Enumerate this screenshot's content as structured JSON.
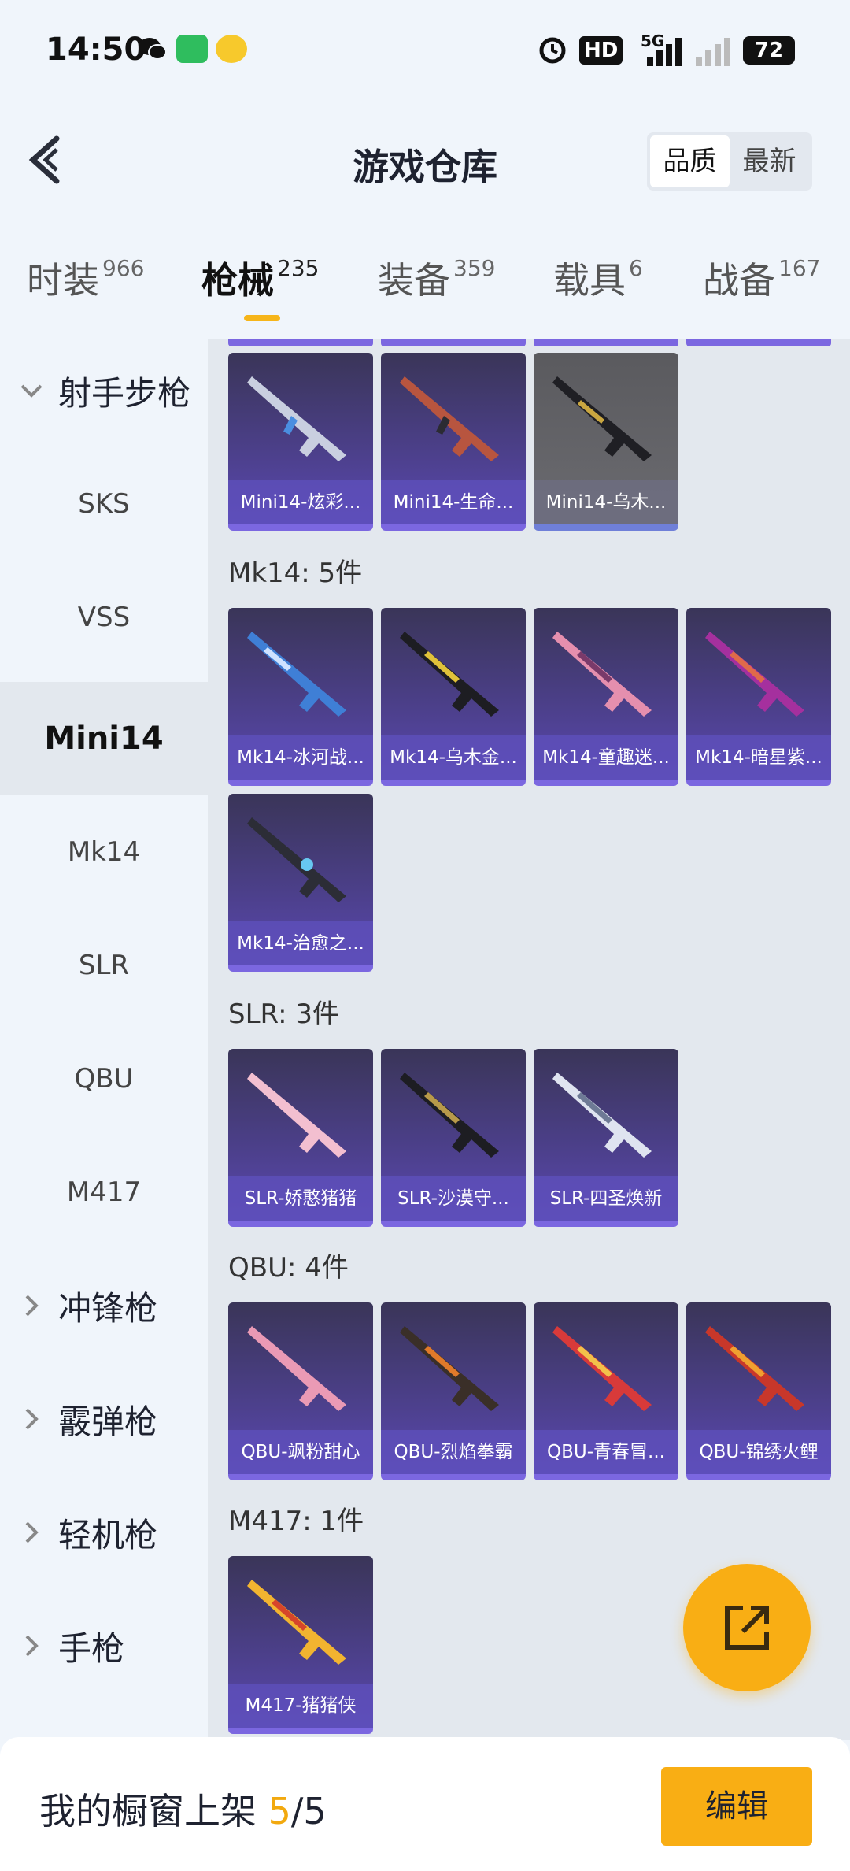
{
  "status_bar": {
    "time": "14:50",
    "hd": "HD",
    "signal": "5G",
    "battery": "72"
  },
  "header": {
    "title": "游戏仓库",
    "sort": [
      "品质",
      "最新"
    ]
  },
  "tabs": [
    {
      "label": "时装",
      "count": "966"
    },
    {
      "label": "枪械",
      "count": "235"
    },
    {
      "label": "装备",
      "count": "359"
    },
    {
      "label": "载具",
      "count": "6"
    },
    {
      "label": "战备",
      "count": "167"
    }
  ],
  "sidebar": {
    "group_open": "射手步枪",
    "items": [
      "SKS",
      "VSS",
      "Mini14",
      "Mk14",
      "SLR",
      "QBU",
      "M417"
    ],
    "groups": [
      "冲锋枪",
      "霰弹枪",
      "轻机枪",
      "手枪"
    ]
  },
  "sections": {
    "mini14": {
      "cards": [
        "Mini14-炫彩...",
        "Mini14-生命...",
        "Mini14-乌木..."
      ]
    },
    "mk14": {
      "title": "Mk14: 5件",
      "cards": [
        "Mk14-冰河战...",
        "Mk14-乌木金...",
        "Mk14-童趣迷...",
        "Mk14-暗星紫...",
        "Mk14-治愈之..."
      ]
    },
    "slr": {
      "title": "SLR: 3件",
      "cards": [
        "SLR-娇憨猪猪",
        "SLR-沙漠守...",
        "SLR-四圣焕新"
      ]
    },
    "qbu": {
      "title": "QBU: 4件",
      "cards": [
        "QBU-飒粉甜心",
        "QBU-烈焰拳霸",
        "QBU-青春冒...",
        "QBU-锦绣火鲤"
      ]
    },
    "m417": {
      "title": "M417: 1件",
      "cards": [
        "M417-猪猪侠"
      ]
    }
  },
  "bottom": {
    "label": "我的橱窗上架",
    "current": "5",
    "sep": "/",
    "total": "5",
    "edit": "编辑"
  },
  "colors": {
    "accent": "#f9ae14",
    "card_purple": "#4b3f88",
    "card_border": "#7b67e0"
  }
}
